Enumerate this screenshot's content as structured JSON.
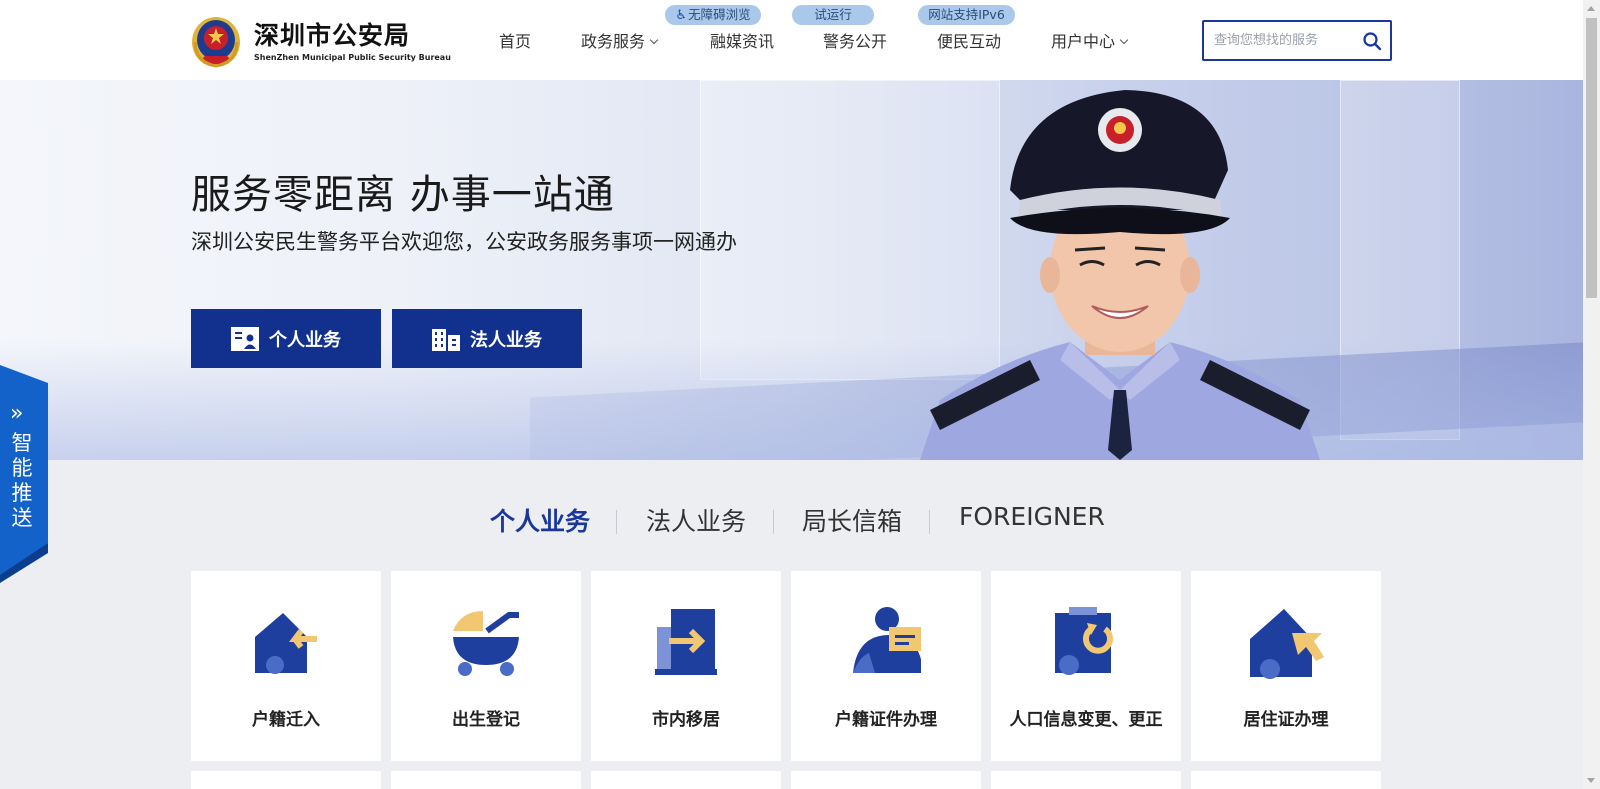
{
  "header": {
    "brand_cn": "深圳市公安局",
    "brand_en": "ShenZhen Municipal Public Security Bureau",
    "nav": [
      {
        "label": "首页",
        "dropdown": false
      },
      {
        "label": "政务服务",
        "dropdown": true
      },
      {
        "label": "融媒资讯",
        "dropdown": false
      },
      {
        "label": "警务公开",
        "dropdown": false
      },
      {
        "label": "便民互动",
        "dropdown": false
      },
      {
        "label": "用户中心",
        "dropdown": true
      }
    ],
    "pills": [
      {
        "label": "无障碍浏览",
        "icon": "wheelchair-icon"
      },
      {
        "label": "试运行"
      },
      {
        "label": "网站支持IPv6"
      }
    ],
    "search_placeholder": "查询您想找的服务",
    "search_icon": "search-icon"
  },
  "banner": {
    "title": "服务零距离 办事一站通",
    "subtitle": "深圳公安民生警务平台欢迎您，公安政务服务事项一网通办",
    "buttons": [
      {
        "label": "个人业务",
        "icon": "id-card-icon"
      },
      {
        "label": "法人业务",
        "icon": "building-icon"
      }
    ]
  },
  "side_tab": {
    "arrow": "»",
    "label": "智能推送"
  },
  "tabs": {
    "items": [
      "个人业务",
      "法人业务",
      "局长信箱",
      "FOREIGNER"
    ],
    "active": "个人业务"
  },
  "services": [
    {
      "label": "户籍迁入",
      "icon": "house-arrow-in-icon"
    },
    {
      "label": "出生登记",
      "icon": "stroller-icon"
    },
    {
      "label": "市内移居",
      "icon": "door-arrow-icon"
    },
    {
      "label": "户籍证件办理",
      "icon": "person-card-icon"
    },
    {
      "label": "人口信息变更、更正",
      "icon": "clipboard-refresh-icon"
    },
    {
      "label": "居住证办理",
      "icon": "house-cursor-icon"
    }
  ],
  "colors": {
    "primary": "#12318f",
    "accent_yellow": "#f2c772",
    "icon_blue": "#1f3f9e",
    "pill_bg": "#a9c8ea"
  }
}
